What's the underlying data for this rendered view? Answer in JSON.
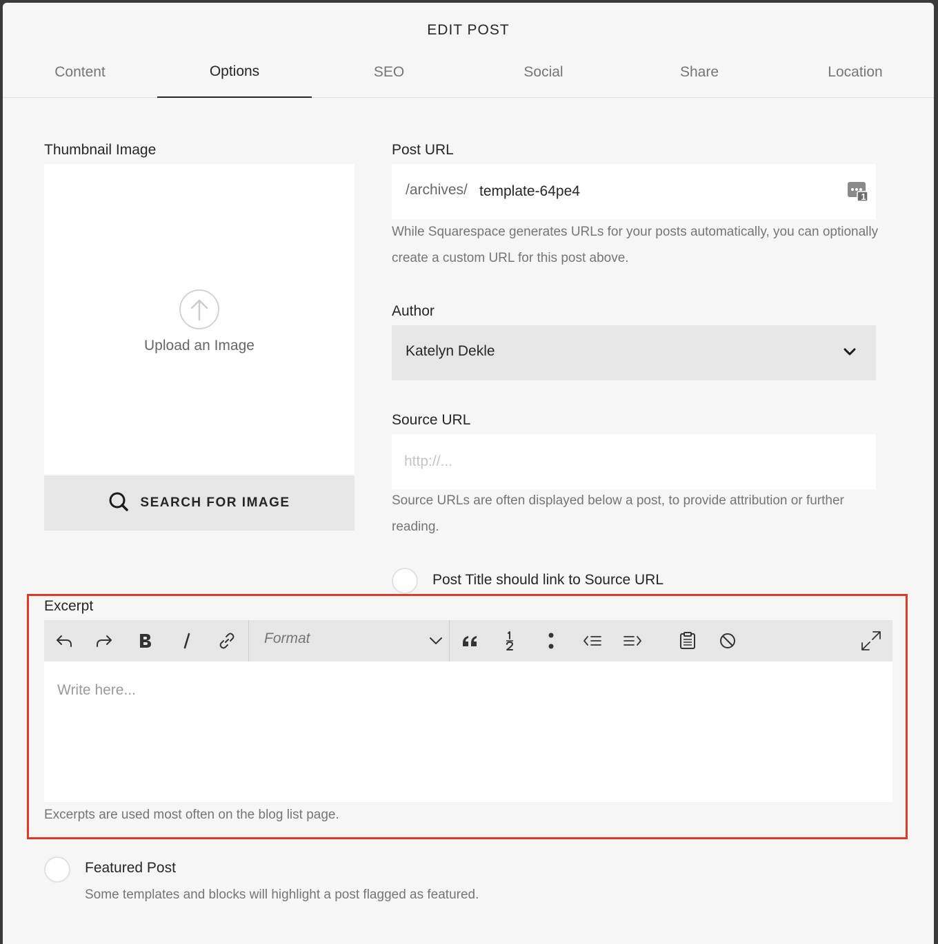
{
  "dialog": {
    "title": "EDIT POST"
  },
  "tabs": [
    {
      "label": "Content",
      "active": false
    },
    {
      "label": "Options",
      "active": true
    },
    {
      "label": "SEO",
      "active": false
    },
    {
      "label": "Social",
      "active": false
    },
    {
      "label": "Share",
      "active": false
    },
    {
      "label": "Location",
      "active": false
    }
  ],
  "thumbnail": {
    "label": "Thumbnail Image",
    "upload_text": "Upload an Image",
    "search_label": "SEARCH FOR IMAGE"
  },
  "post_url": {
    "label": "Post URL",
    "prefix": "/archives/",
    "value": "template-64pe4",
    "badge_count": "1",
    "help": "While Squarespace generates URLs for your posts automatically, you can optionally create a custom URL for this post above."
  },
  "author": {
    "label": "Author",
    "selected": "Katelyn Dekle"
  },
  "source_url": {
    "label": "Source URL",
    "placeholder": "http://...",
    "help": "Source URLs are often displayed below a post, to provide attribution or further reading.",
    "link_toggle_label": "Post Title should link to Source URL"
  },
  "excerpt": {
    "label": "Excerpt",
    "format_label": "Format",
    "placeholder": "Write here...",
    "help": "Excerpts are used most often on the blog list page."
  },
  "featured": {
    "label": "Featured Post",
    "help": "Some templates and blocks will highlight a post flagged as featured."
  },
  "colors": {
    "highlight": "#e03a25",
    "background": "#f6f6f6",
    "toolbar": "#e6e6e6"
  }
}
